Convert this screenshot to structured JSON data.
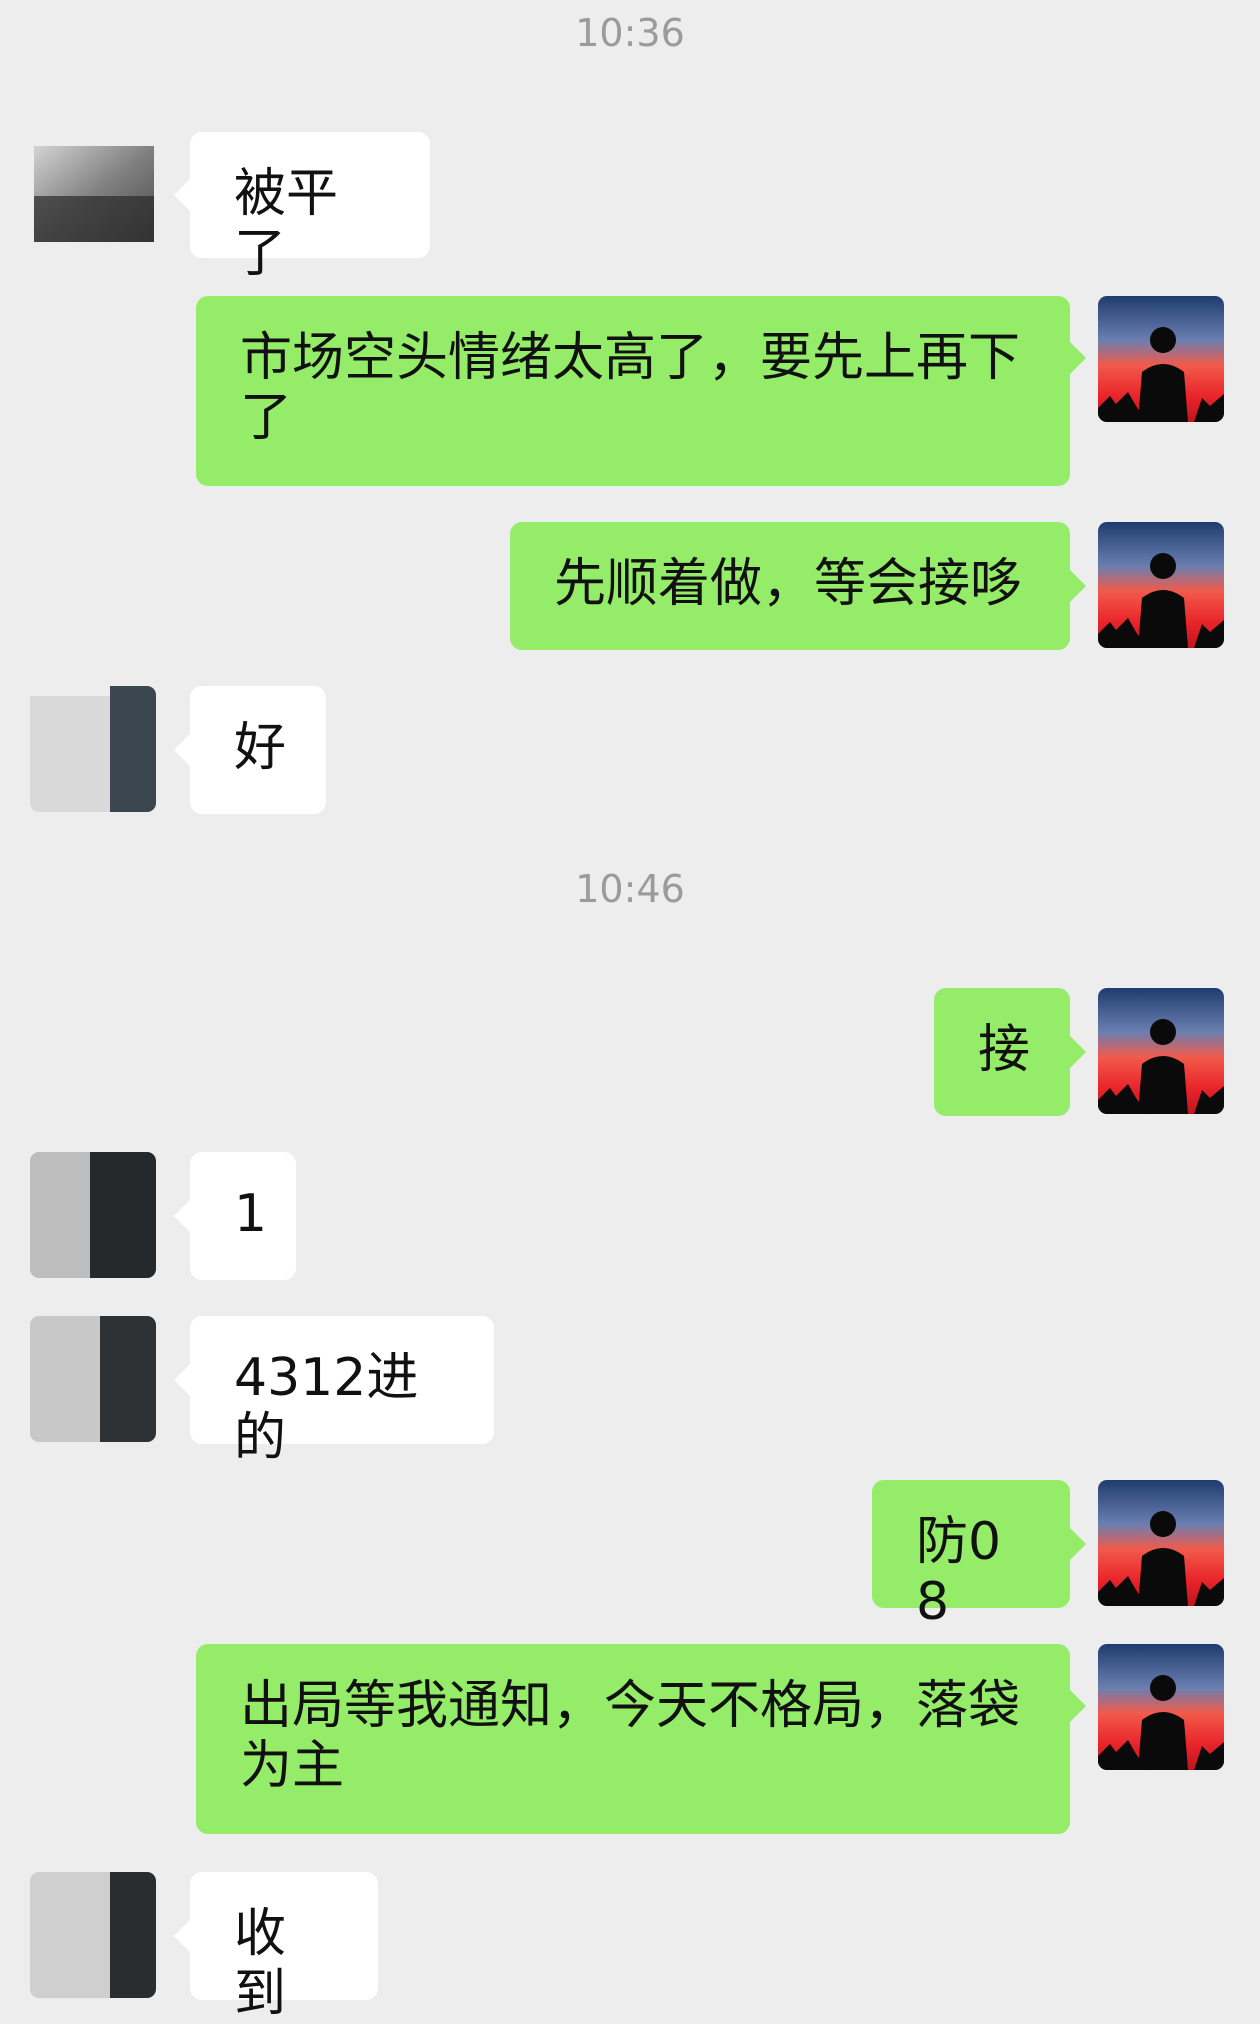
{
  "timestamps": [
    "10:36",
    "10:46"
  ],
  "messages": [
    {
      "side": "left",
      "text": "被平了"
    },
    {
      "side": "right",
      "text": "市场空头情绪太高了，要先上再下了"
    },
    {
      "side": "right",
      "text": "先顺着做，等会接哆"
    },
    {
      "side": "left",
      "text": "好"
    },
    {
      "side": "right",
      "text": "接"
    },
    {
      "side": "left",
      "text": "1"
    },
    {
      "side": "left",
      "text": "4312进的"
    },
    {
      "side": "right",
      "text": "防08"
    },
    {
      "side": "right",
      "text": "出局等我通知，今天不格局，落袋为主"
    },
    {
      "side": "left",
      "text": "收到"
    }
  ],
  "colors": {
    "background": "#ededed",
    "my_bubble": "#95ec69",
    "their_bubble": "#ffffff",
    "timestamp": "#9b9b9b"
  },
  "avatars": {
    "me": "sunset-silhouette-avatar",
    "contact": "obscured-avatar"
  }
}
